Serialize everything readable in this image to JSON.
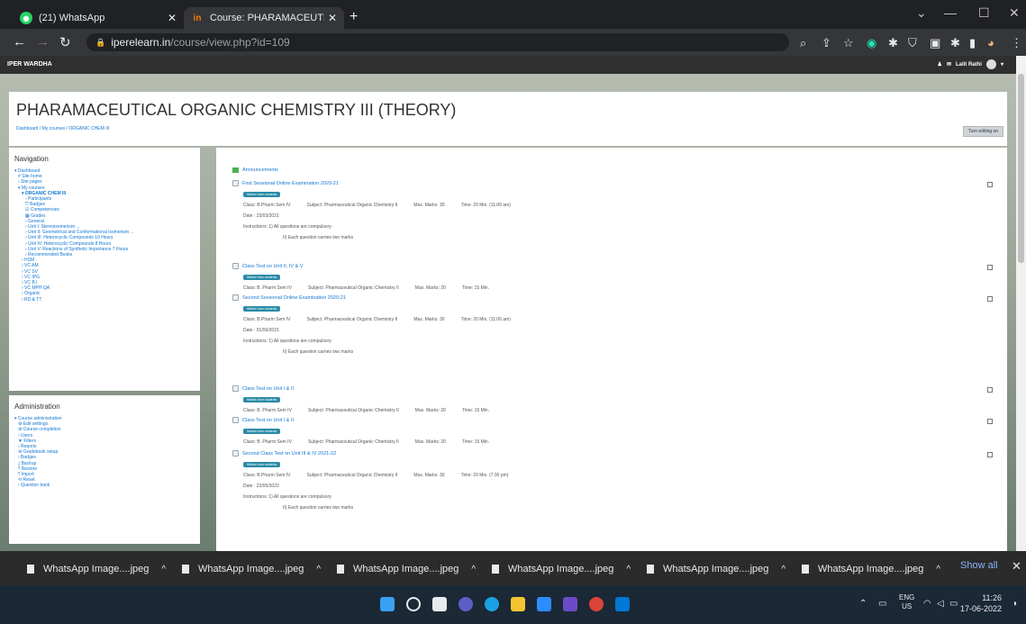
{
  "browser": {
    "tabs": [
      {
        "label": "(21) WhatsApp",
        "favicon": "whatsapp-icon"
      },
      {
        "label": "Course: PHARAMACEUTICAL OR",
        "favicon": "moodle-in-icon"
      }
    ],
    "url_domain": "iperelearn.in",
    "url_path": "/course/view.php?id=109",
    "new_tab": "+",
    "window_controls": [
      "⌄",
      "—",
      "☐",
      "✕"
    ]
  },
  "site": {
    "name": "IPER WARDHA",
    "user": "Lalit Rathi"
  },
  "course": {
    "title": "PHARAMACEUTICAL ORGANIC CHEMISTRY III (THEORY)",
    "breadcrumb": "Dashboard / My courses / ORGANIC CHEM III",
    "edit_button": "Turn editing on"
  },
  "navigation": {
    "title": "Navigation",
    "items": [
      {
        "label": "▾ Dashboard",
        "level": 1
      },
      {
        "label": "# Site home",
        "level": 2
      },
      {
        "label": "› Site pages",
        "level": 2
      },
      {
        "label": "▾ My courses",
        "level": 2
      },
      {
        "label": "▾ ORGANIC CHEM III",
        "level": 3,
        "bold": true
      },
      {
        "label": "› Participants",
        "level": 4
      },
      {
        "label": "⛉ Badges",
        "level": 4
      },
      {
        "label": "☑ Competencies",
        "level": 4
      },
      {
        "label": "▦ Grades",
        "level": 4
      },
      {
        "label": "› General",
        "level": 4
      },
      {
        "label": "› Unit I: Stereoisomerism ...",
        "level": 4
      },
      {
        "label": "› Unit II: Geometrical and Conformational isomerism ...",
        "level": 4
      },
      {
        "label": "› Unit III: Heterocyclic Compounds 10 Hours",
        "level": 4
      },
      {
        "label": "› Unit IV: Heterocyclic Compounds 8 Hours",
        "level": 4
      },
      {
        "label": "› Unit V: Reactions of Synthetic Importance 7 Hours",
        "level": 4
      },
      {
        "label": "› Recommended Books",
        "level": 4
      },
      {
        "label": "› HSM",
        "level": 3
      },
      {
        "label": "› VC AM",
        "level": 3
      },
      {
        "label": "› VC SV",
        "level": 3
      },
      {
        "label": "› VC IPG",
        "level": 3
      },
      {
        "label": "› VC B.I",
        "level": 3
      },
      {
        "label": "› VC MPH QA",
        "level": 3
      },
      {
        "label": "› Organic",
        "level": 3
      },
      {
        "label": "› RD & TT",
        "level": 3
      }
    ]
  },
  "administration": {
    "title": "Administration",
    "items": [
      {
        "label": "▾ Course administration",
        "level": 1
      },
      {
        "label": "⚙ Edit settings",
        "level": 2
      },
      {
        "label": "⚙ Course completion",
        "level": 2
      },
      {
        "label": "› Users",
        "level": 2
      },
      {
        "label": "▼ Filters",
        "level": 2
      },
      {
        "label": "› Reports",
        "level": 2
      },
      {
        "label": "⚙ Gradebook setup",
        "level": 2
      },
      {
        "label": "› Badges",
        "level": 2
      },
      {
        "label": "⤓ Backup",
        "level": 2
      },
      {
        "label": "⤒ Restore",
        "level": 2
      },
      {
        "label": "⤒ Import",
        "level": 2
      },
      {
        "label": "⟲ Reset",
        "level": 2
      },
      {
        "label": "› Question bank",
        "level": 2
      }
    ]
  },
  "content": {
    "announcements": "Announcements",
    "hidden_badge": "Hidden from students",
    "activities": [
      {
        "title": "First Sessional Online Examination 2020-21",
        "class": "Class: B.Pharm Sem IV",
        "subject": "Subject: Pharmaceutical Organic Chemistry II",
        "marks": "Max. Marks: 30",
        "time": "Time: 20 Min. (11.00 am)",
        "date": "Date : 22/03/2021",
        "instr1": "Instructions: 1) All questions are compulsory",
        "instr2": "II) Each question carries two marks"
      },
      {
        "title": "Class Test on Unit II, IV & V",
        "class": "Class: B. Pharm Sem IV",
        "subject": "Subject: Pharmaceutical Organic Chemistry II",
        "marks": "Max. Marks: 20",
        "time": "Time: 15 Min."
      },
      {
        "title": "Second Sessional Online Examination 2020-21",
        "class": "Class: B.Pharm Sem IV",
        "subject": "Subject: Pharmaceutical Organic Chemistry II",
        "marks": "Max. Marks: 30",
        "time": "Time: 20 Min. (11.00 am)",
        "date": "Date : 01/06/2021",
        "instr1": "Instructions: 1) All questions are compulsory",
        "instr2": "II) Each question carries two marks"
      },
      {
        "title": "Class Test on Unit I & II",
        "class": "Class: B. Pharm Sem IV",
        "subject": "Subject: Pharmaceutical Organic Chemistry II",
        "marks": "Max. Marks: 20",
        "time": "Time: 15 Min."
      },
      {
        "title": "Class Test on Unit I & II",
        "class": "Class: B. Pharm Sem IV",
        "subject": "Subject: Pharmaceutical Organic Chemistry II",
        "marks": "Max. Marks: 20",
        "time": "Time: 15 Min."
      },
      {
        "title": "Second Class Test on Unit III & IV 2021-22",
        "class": "Class: B.Pharm Sem IV",
        "subject": "Subject: Pharmaceutical Organic Chemistry II",
        "marks": "Max. Marks: 30",
        "time": "Time: 20 Min. (7.30 pm)",
        "date": "Date : 22/05/2022",
        "instr1": "Instructions: 1) All questions are compulsory",
        "instr2": "II) Each question carries two marks"
      }
    ]
  },
  "downloads": {
    "items": [
      "WhatsApp Image....jpeg",
      "WhatsApp Image....jpeg",
      "WhatsApp Image....jpeg",
      "WhatsApp Image....jpeg",
      "WhatsApp Image....jpeg",
      "WhatsApp Image....jpeg"
    ],
    "show_all": "Show all"
  },
  "taskbar": {
    "lang_top": "ENG",
    "lang_bottom": "US",
    "time": "11:26",
    "date": "17-06-2022"
  }
}
